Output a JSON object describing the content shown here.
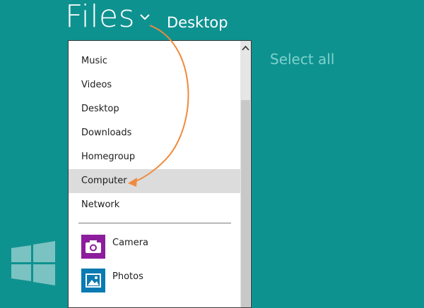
{
  "header": {
    "title": "Files",
    "location": "Desktop",
    "select_all": "Select all"
  },
  "locations": [
    {
      "label": "Music"
    },
    {
      "label": "Videos"
    },
    {
      "label": "Desktop"
    },
    {
      "label": "Downloads"
    },
    {
      "label": "Homegroup"
    },
    {
      "label": "Computer",
      "selected": true
    },
    {
      "label": "Network"
    }
  ],
  "apps": [
    {
      "label": "Camera",
      "icon": "camera-icon",
      "color": "#8c1d9c"
    },
    {
      "label": "Photos",
      "icon": "photos-icon",
      "color": "#0a7ab2"
    }
  ],
  "colors": {
    "background": "#0e9290",
    "selected_row": "#dcdcdc",
    "annotation_arrow": "#f08a3c"
  }
}
